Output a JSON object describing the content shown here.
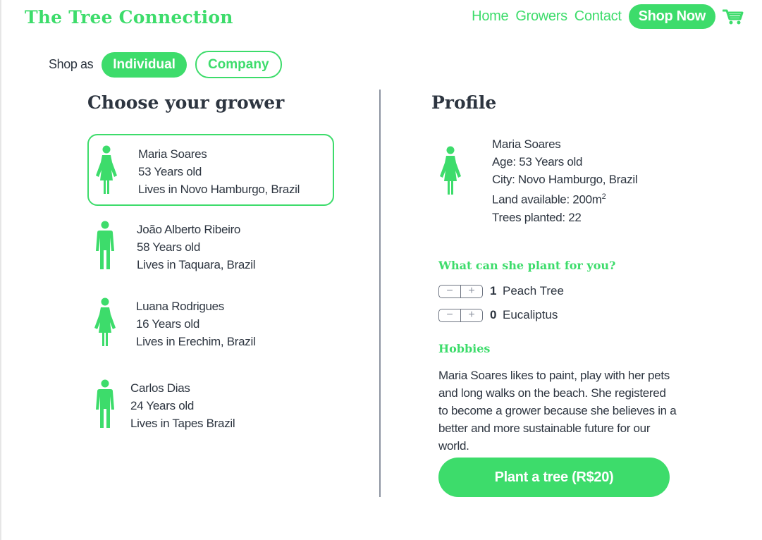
{
  "brand": "The Tree Connection",
  "colors": {
    "accent": "#3ddc6b",
    "text": "#2d3540"
  },
  "nav": {
    "home": "Home",
    "growers": "Growers",
    "contact": "Contact",
    "shop_now": "Shop Now",
    "cart_icon": "cart-icon"
  },
  "shop_as": {
    "label": "Shop as",
    "options": [
      "Individual",
      "Company"
    ],
    "selected": "Individual"
  },
  "growers_section": {
    "title": "Choose your grower",
    "growers": [
      {
        "name": "Maria Soares",
        "age": "53 Years old",
        "location": "Lives in Novo Hamburgo, Brazil",
        "icon": "female-person-icon",
        "selected": true
      },
      {
        "name": "João Alberto Ribeiro",
        "age": "58 Years old",
        "location": "Lives in Taquara, Brazil",
        "icon": "male-person-icon",
        "selected": false
      },
      {
        "name": "Luana Rodrigues",
        "age": "16 Years old",
        "location": "Lives in Erechim, Brazil",
        "icon": "female-person-icon",
        "selected": false
      },
      {
        "name": "Carlos Dias",
        "age": "24 Years old",
        "location": "Lives in Tapes Brazil",
        "icon": "male-person-icon",
        "selected": false
      }
    ]
  },
  "profile": {
    "title": "Profile",
    "name": "Maria Soares",
    "age": "Age: 53 Years old",
    "city": "City: Novo Hamburgo, Brazil",
    "land": "Land available: 200m",
    "land_sup": "2",
    "trees": "Trees planted: 22",
    "plant_heading": "What can she plant for you?",
    "trees_options": [
      {
        "qty": "1",
        "name": "Peach Tree"
      },
      {
        "qty": "0",
        "name": "Eucaliptus"
      }
    ],
    "hobbies_heading": "Hobbies",
    "hobbies_text": "Maria Soares likes to paint, play with her pets and long walks on the beach. She registered to become a grower because she believes in a better and more sustainable future for our world.",
    "cta": "Plant a tree (R$20)"
  }
}
